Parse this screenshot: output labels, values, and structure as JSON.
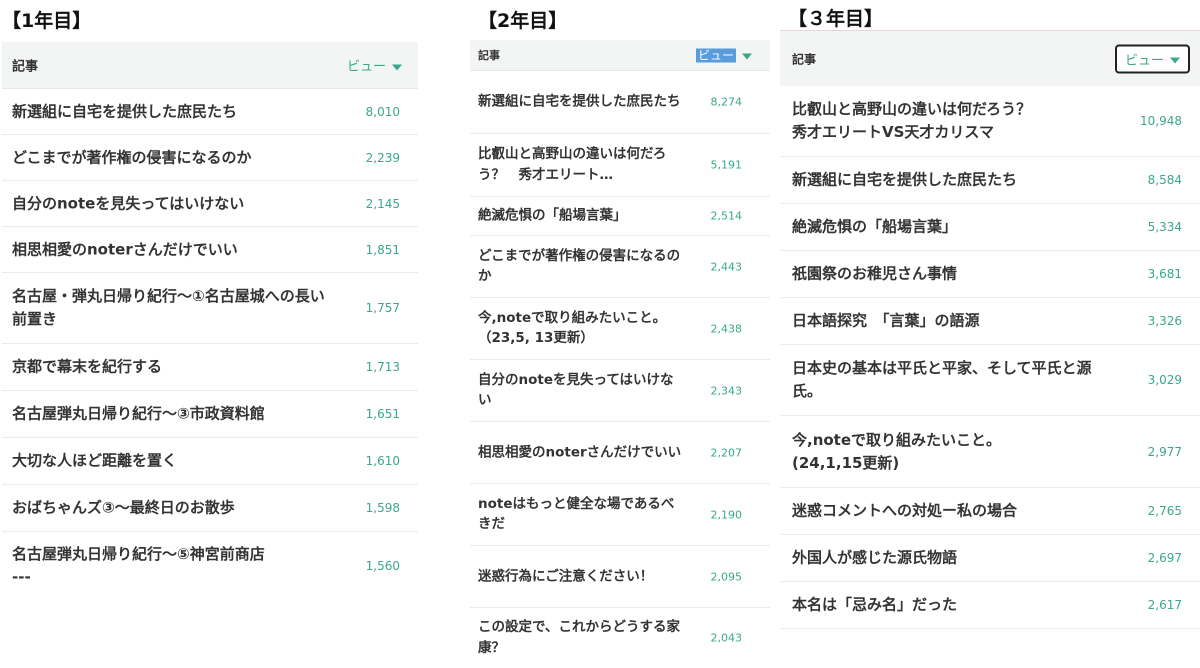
{
  "panels": [
    {
      "title": "【1年目】",
      "header": {
        "article_label": "記事",
        "sort_label": "ビュー"
      },
      "rows": [
        {
          "title": "新選組に自宅を提供した庶民たち",
          "views": "8,010"
        },
        {
          "title": "どこまでが著作権の侵害になるのか",
          "views": "2,239"
        },
        {
          "title": "自分のnoteを見失ってはいけない",
          "views": "2,145"
        },
        {
          "title": "相思相愛のnoterさんだけでいい",
          "views": "1,851"
        },
        {
          "title": "名古屋・弾丸日帰り紀行～①名古屋城への長い前置き",
          "views": "1,757"
        },
        {
          "title": "京都で幕末を紀行する",
          "views": "1,713"
        },
        {
          "title": "名古屋弾丸日帰り紀行～③市政資料館",
          "views": "1,651"
        },
        {
          "title": "大切な人ほど距離を置く",
          "views": "1,610"
        },
        {
          "title": "おばちゃんズ③～最終日のお散歩",
          "views": "1,598"
        },
        {
          "title": "名古屋弾丸日帰り紀行～⑤神宮前商店\n---",
          "views": "1,560"
        }
      ]
    },
    {
      "title": "【2年目】",
      "header": {
        "article_label": "記事",
        "sort_label": "ビュー"
      },
      "rows": [
        {
          "title": "新選組に自宅を提供した庶民たち",
          "views": "8,274"
        },
        {
          "title": "比叡山と高野山の違いは何だろう？　秀才エリート…",
          "views": "5,191"
        },
        {
          "title": "絶滅危惧の「船場言葉」",
          "views": "2,514"
        },
        {
          "title": "どこまでが著作権の侵害になるのか",
          "views": "2,443"
        },
        {
          "title": "今,noteで取り組みたいこと。　　（23,5, 13更新）",
          "views": "2,438"
        },
        {
          "title": "自分のnoteを見失ってはいけない",
          "views": "2,343"
        },
        {
          "title": "相思相愛のnoterさんだけでいい",
          "views": "2,207"
        },
        {
          "title": "noteはもっと健全な場であるべきだ",
          "views": "2,190"
        },
        {
          "title": "迷惑行為にご注意ください！",
          "views": "2,095"
        },
        {
          "title": "この設定で、これからどうする家康？",
          "views": "2,043"
        }
      ]
    },
    {
      "title": "【３年目】",
      "header": {
        "article_label": "記事",
        "sort_label": "ビュー"
      },
      "rows": [
        {
          "title": "比叡山と高野山の違いは何だろう？\n秀才エリートVS天才カリスマ",
          "views": "10,948"
        },
        {
          "title": "新選組に自宅を提供した庶民たち",
          "views": "8,584"
        },
        {
          "title": "絶滅危惧の「船場言葉」",
          "views": "5,334"
        },
        {
          "title": "祇園祭のお稚児さん事情",
          "views": "3,681"
        },
        {
          "title": "日本語探究　「言葉」の語源",
          "views": "3,326"
        },
        {
          "title": "日本史の基本は平氏と平家、そして平氏と源氏。",
          "views": "3,029"
        },
        {
          "title": "今,noteで取り組みたいこと。\n(24,1,15更新)",
          "views": "2,977"
        },
        {
          "title": "迷惑コメントへの対処ー私の場合",
          "views": "2,765"
        },
        {
          "title": "外国人が感じた源氏物語",
          "views": "2,697"
        },
        {
          "title": "本名は「忌み名」だった",
          "views": "2,617"
        }
      ]
    }
  ]
}
